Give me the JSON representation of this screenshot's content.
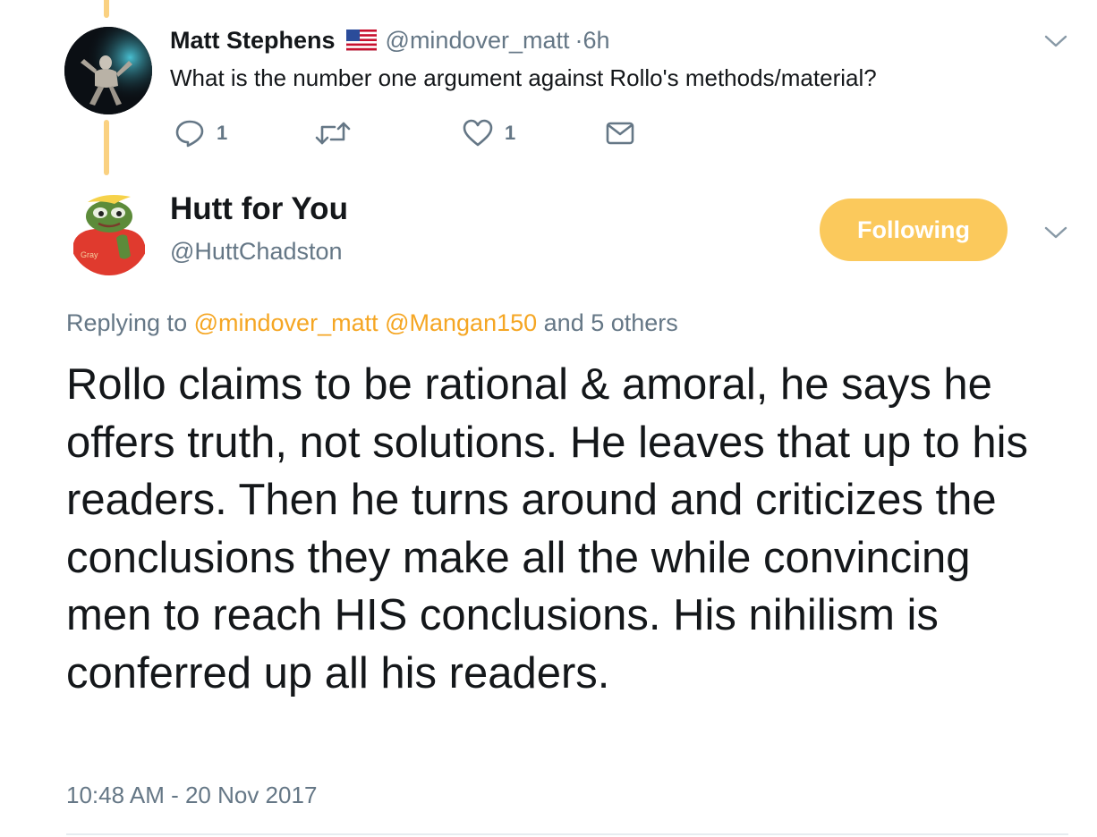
{
  "parent_tweet": {
    "name": "Matt Stephens",
    "flag_icon": "us-flag-icon",
    "handle": "@mindover_matt",
    "time": "·6h",
    "text": "What is the number one argument against Rollo's methods/material?",
    "actions": {
      "reply_count": "1",
      "retweet_count": "",
      "like_count": "1"
    }
  },
  "main_tweet": {
    "name": "Hutt for You",
    "handle": "@HuttChadston",
    "follow_label": "Following",
    "replying": {
      "prefix": "Replying to",
      "mention_1": "@mindover_matt",
      "mention_2": "@Mangan150",
      "suffix": "and 5 others"
    },
    "text": "Rollo claims to be rational & amoral, he says he offers truth, not solutions. He leaves that up to his readers. Then he turns around and criticizes the conclusions they make all the while convincing men to reach HIS conclusions. His nihilism is conferred up all his readers.",
    "timestamp": "10:48 AM - 20 Nov 2017",
    "avatar_shirt_text": "Gray"
  },
  "colors": {
    "accent": "#fbc95c",
    "mention": "#f5a623",
    "thread_line": "#fad181",
    "secondary_text": "#657786"
  }
}
